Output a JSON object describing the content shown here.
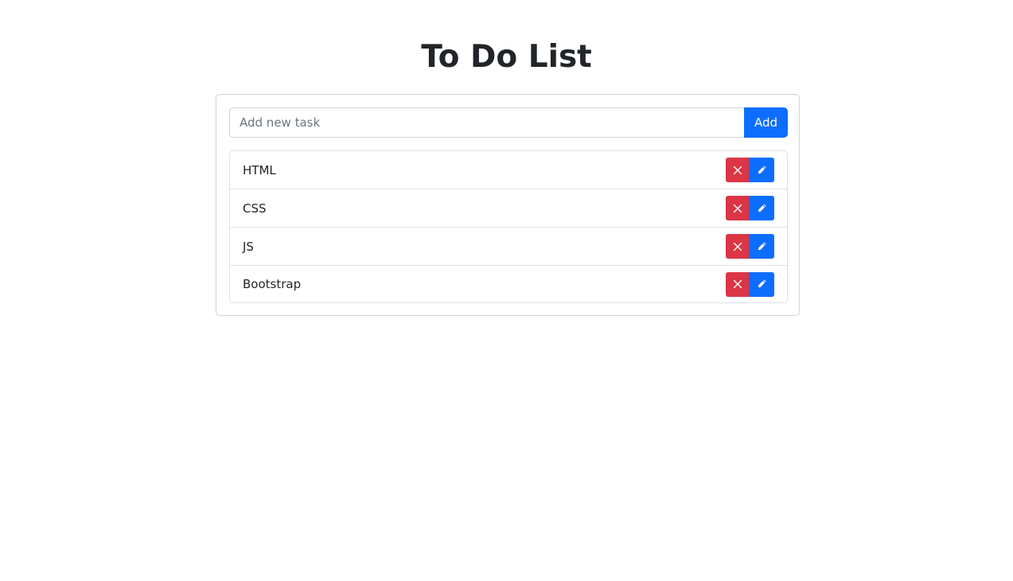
{
  "page": {
    "title": "To Do List"
  },
  "form": {
    "input_placeholder": "Add new task",
    "input_value": "",
    "add_label": "Add"
  },
  "tasks": [
    {
      "label": "HTML",
      "delete_icon": "close-icon",
      "edit_icon": "pencil-icon"
    },
    {
      "label": "CSS",
      "delete_icon": "close-icon",
      "edit_icon": "pencil-icon"
    },
    {
      "label": "JS",
      "delete_icon": "close-icon",
      "edit_icon": "pencil-icon"
    },
    {
      "label": "Bootstrap",
      "delete_icon": "close-icon",
      "edit_icon": "pencil-icon"
    }
  ],
  "colors": {
    "primary": "#0d6efd",
    "danger": "#dc3545",
    "text": "#212529",
    "border": "#dee2e6"
  }
}
